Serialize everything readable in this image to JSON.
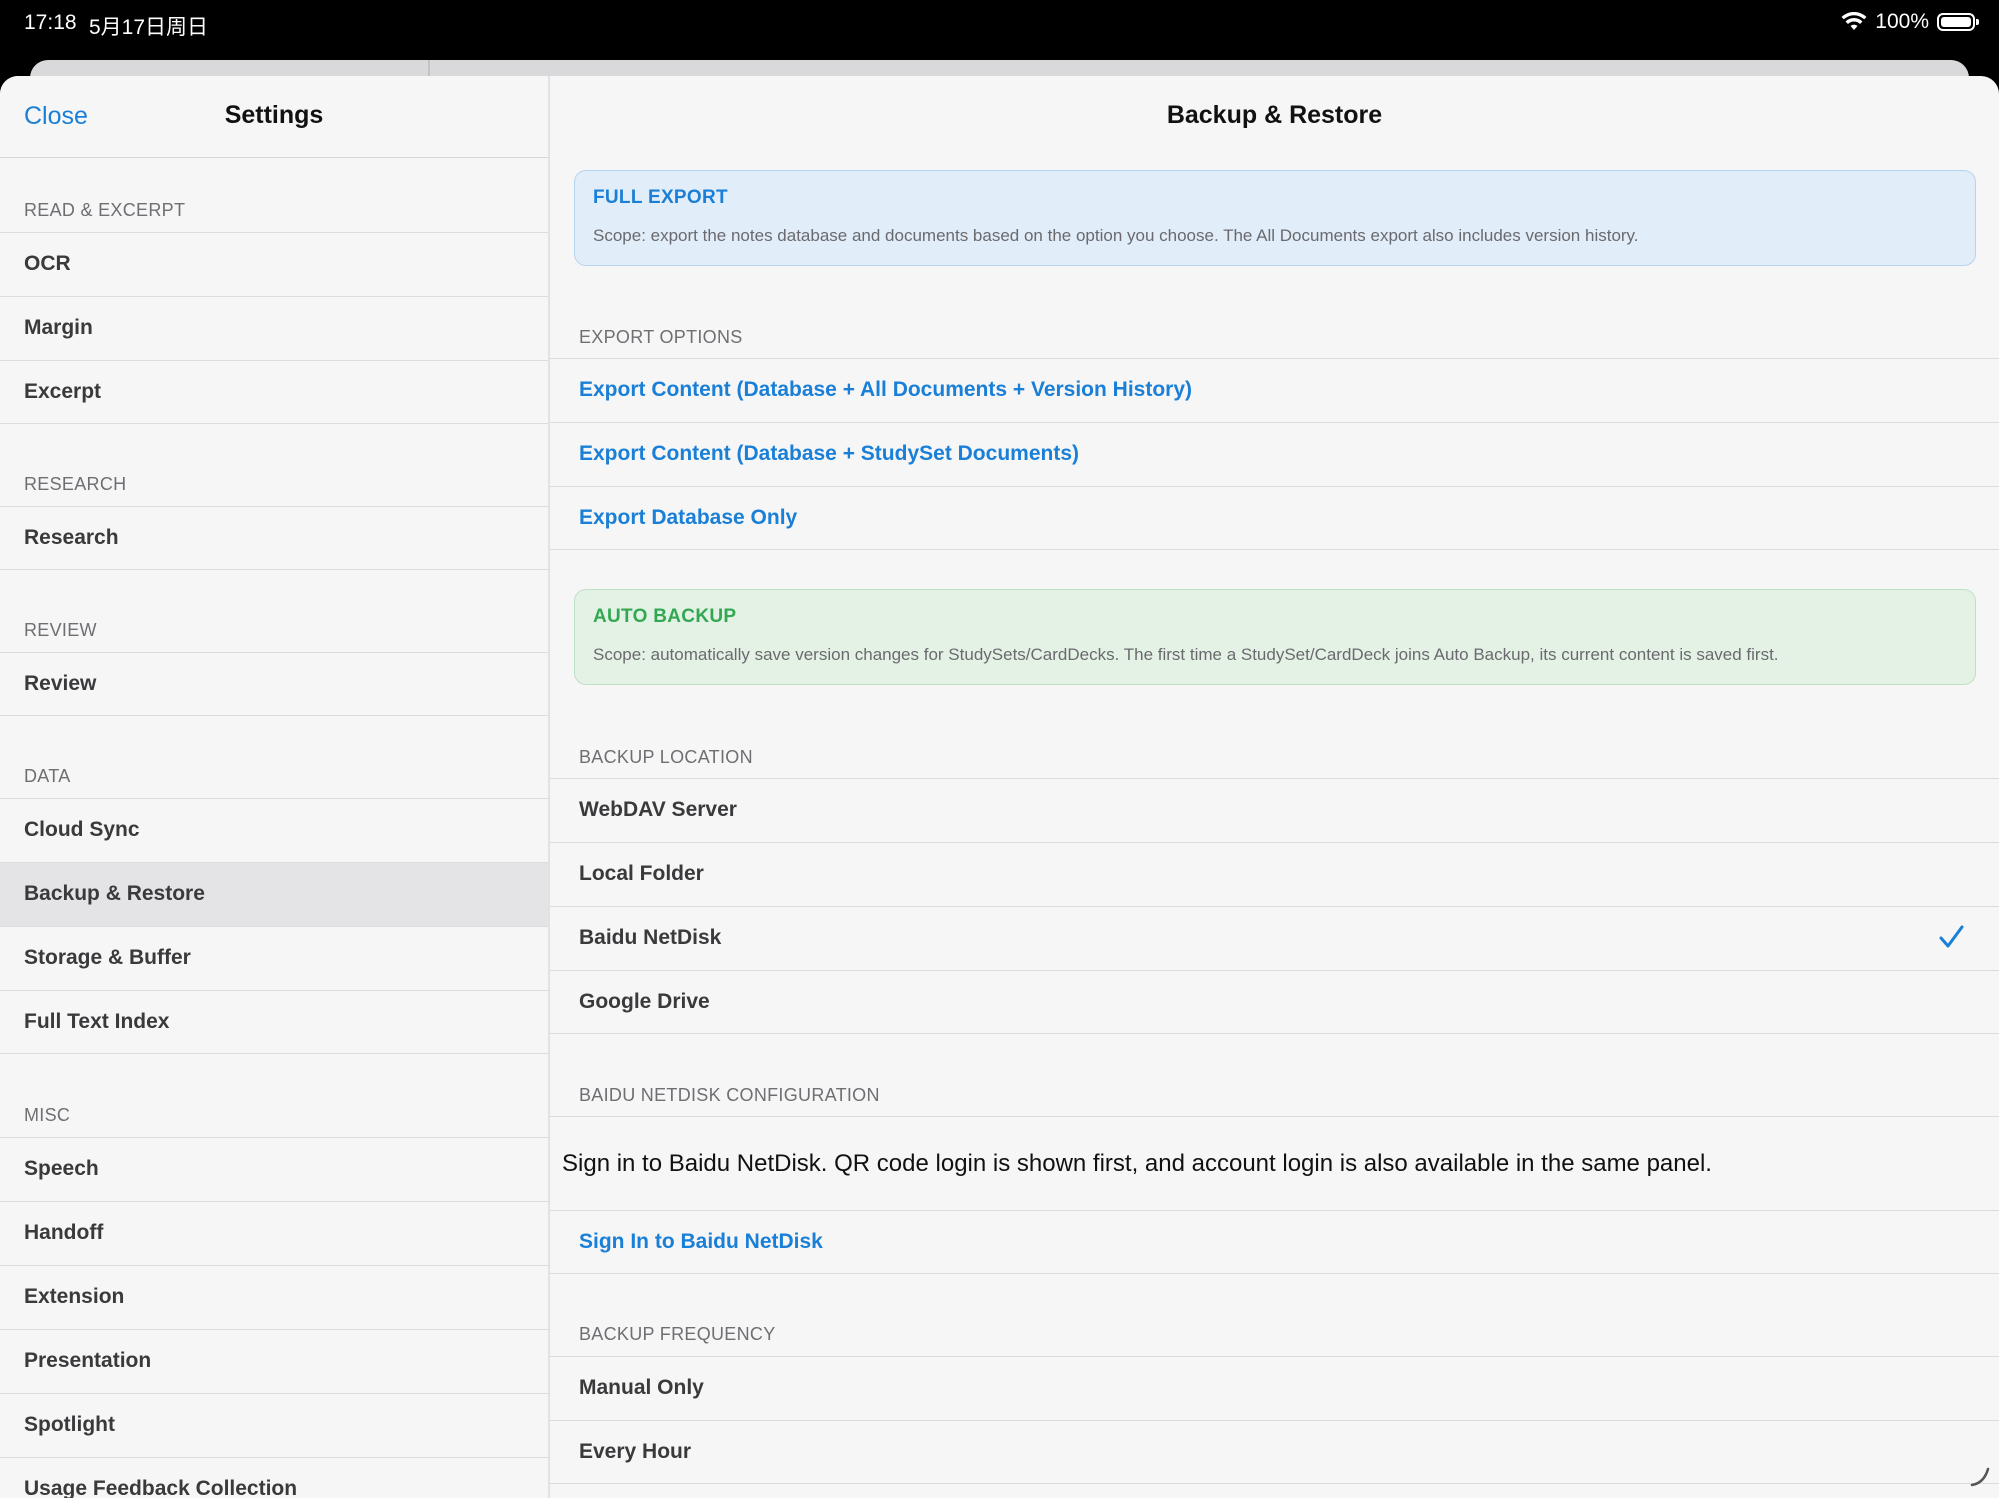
{
  "status": {
    "time": "17:18",
    "date": "5月17日周日",
    "battery": "100%"
  },
  "left": {
    "close_label": "Close",
    "title": "Settings",
    "sections": [
      {
        "label": "READ & EXCERPT",
        "items": [
          "OCR",
          "Margin",
          "Excerpt"
        ]
      },
      {
        "label": "RESEARCH",
        "items": [
          "Research"
        ]
      },
      {
        "label": "REVIEW",
        "items": [
          "Review"
        ]
      },
      {
        "label": "DATA",
        "items": [
          "Cloud Sync",
          "Backup & Restore",
          "Storage & Buffer",
          "Full Text Index"
        ]
      },
      {
        "label": "MISC",
        "items": [
          "Speech",
          "Handoff",
          "Extension",
          "Presentation",
          "Spotlight",
          "Usage Feedback Collection"
        ]
      }
    ],
    "selected_item": "Backup & Restore"
  },
  "right": {
    "title": "Backup & Restore",
    "full_export": {
      "title": "FULL EXPORT",
      "text": "Scope: export the notes database and documents based on the option you choose. The All Documents export also includes version history."
    },
    "export_options": {
      "label": "EXPORT OPTIONS",
      "items": [
        "Export Content (Database + All Documents + Version History)",
        "Export Content (Database + StudySet Documents)",
        "Export Database Only"
      ]
    },
    "auto_backup": {
      "title": "AUTO BACKUP",
      "text": "Scope: automatically save version changes for StudySets/CardDecks. The first time a StudySet/CardDeck joins Auto Backup, its current content is saved first."
    },
    "backup_location": {
      "label": "BACKUP LOCATION",
      "items": [
        "WebDAV Server",
        "Local Folder",
        "Baidu NetDisk",
        "Google Drive"
      ],
      "selected": "Baidu NetDisk"
    },
    "baidu_config": {
      "label": "BAIDU NETDISK CONFIGURATION",
      "description": "Sign in to Baidu NetDisk. QR code login is shown first, and account login is also available in the same panel.",
      "sign_in_label": "Sign In to Baidu NetDisk"
    },
    "backup_frequency": {
      "label": "BACKUP FREQUENCY",
      "items": [
        "Manual Only",
        "Every Hour"
      ]
    }
  },
  "colors": {
    "accent": "#1a7fd6",
    "auto_backup_green": "#32a852",
    "selected_row": "#e4e4e6"
  }
}
